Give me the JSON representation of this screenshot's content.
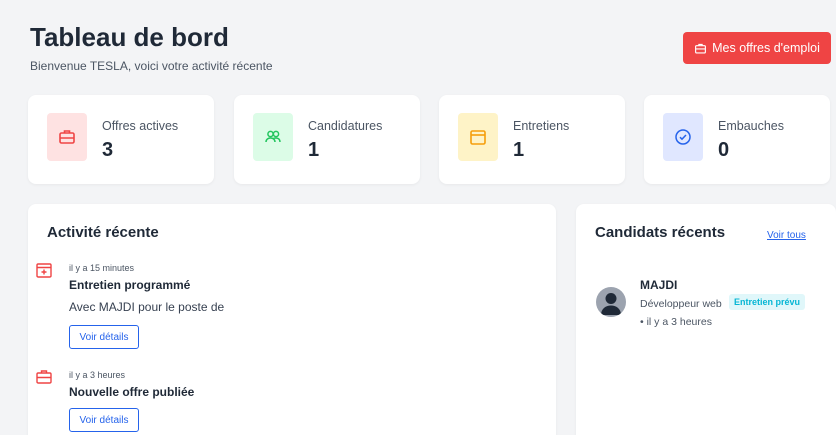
{
  "header": {
    "title": "Tableau de bord",
    "subtitle": "Bienvenue TESLA, voici votre activité récente",
    "offers_button": "Mes offres d'emploi"
  },
  "stats": [
    {
      "label": "Offres actives",
      "value": "3",
      "icon": "briefcase-icon",
      "color": "#ef4444",
      "bg": "#fee2e2"
    },
    {
      "label": "Candidatures",
      "value": "1",
      "icon": "users-icon",
      "color": "#22c55e",
      "bg": "#dcfce7"
    },
    {
      "label": "Entretiens",
      "value": "1",
      "icon": "calendar-icon",
      "color": "#f59e0b",
      "bg": "#fef3c7"
    },
    {
      "label": "Embauches",
      "value": "0",
      "icon": "check-circle-icon",
      "color": "#2563eb",
      "bg": "#e0e7ff"
    }
  ],
  "activity": {
    "title": "Activité récente",
    "items": [
      {
        "icon": "calendar-plus-icon",
        "time": "il y a 15 minutes",
        "title": "Entretien programmé",
        "description": "Avec MAJDI pour le poste de",
        "button": "Voir détails"
      },
      {
        "icon": "briefcase-icon",
        "time": "il y a 3 heures",
        "title": "Nouvelle offre publiée",
        "button": "Voir détails"
      }
    ]
  },
  "candidates": {
    "title": "Candidats récents",
    "see_all": "Voir tous",
    "items": [
      {
        "name": "MAJDI",
        "role": "Développeur web",
        "status": "Entretien prévu",
        "time": "• il y a 3 heures"
      }
    ]
  },
  "colors": {
    "accent": "#ef4444",
    "link": "#2563eb",
    "badge": "#06b6d4"
  }
}
